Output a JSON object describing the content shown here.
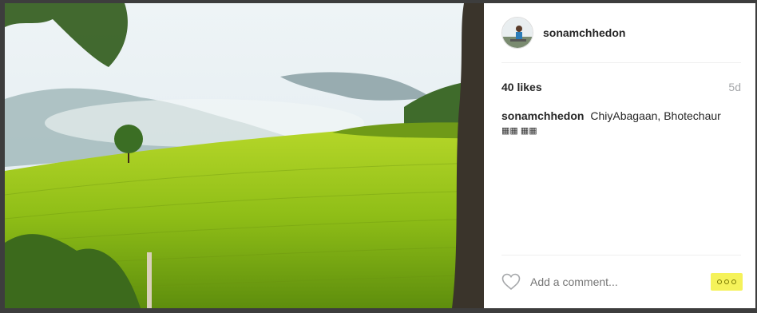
{
  "post": {
    "username": "sonamchhedon",
    "likes": "40 likes",
    "age": "5d",
    "caption_user": "sonamchhedon",
    "caption_text": "ChiyAbagaan, Bhotechaur",
    "caption_emoji": "▦▦ ▦▦",
    "comment_placeholder": "Add a comment...",
    "more_icon": "ellipsis-icon",
    "heart_icon": "heart-outline-icon"
  },
  "colors": {
    "highlight": "#f5f25a",
    "muted": "#a5a7aa",
    "text": "#262626"
  }
}
